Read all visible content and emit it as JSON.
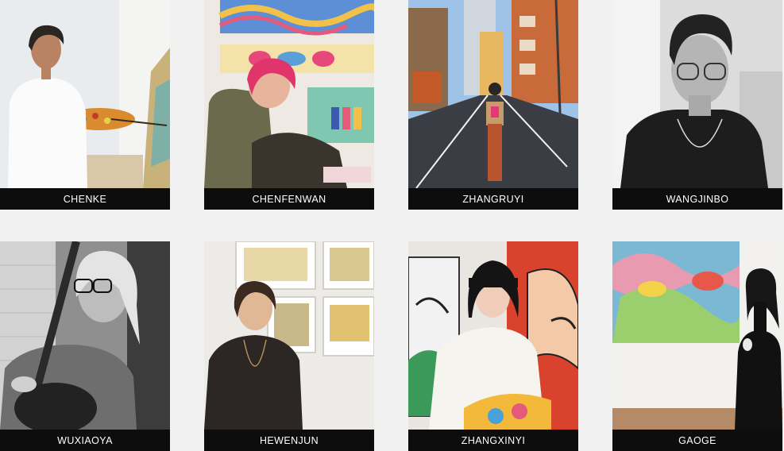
{
  "artists": [
    {
      "name": "CHENKE"
    },
    {
      "name": "CHENFENWAN"
    },
    {
      "name": "ZHANGRUYI"
    },
    {
      "name": "WANGJINBO"
    },
    {
      "name": "WUXIAOYA"
    },
    {
      "name": "HEWENJUN"
    },
    {
      "name": "ZHANGXINYI"
    },
    {
      "name": "GAOGE"
    }
  ],
  "colors": {
    "page_background": "#f1f1f1",
    "caption_background": "#0d0d0d",
    "caption_text": "#ffffff"
  }
}
